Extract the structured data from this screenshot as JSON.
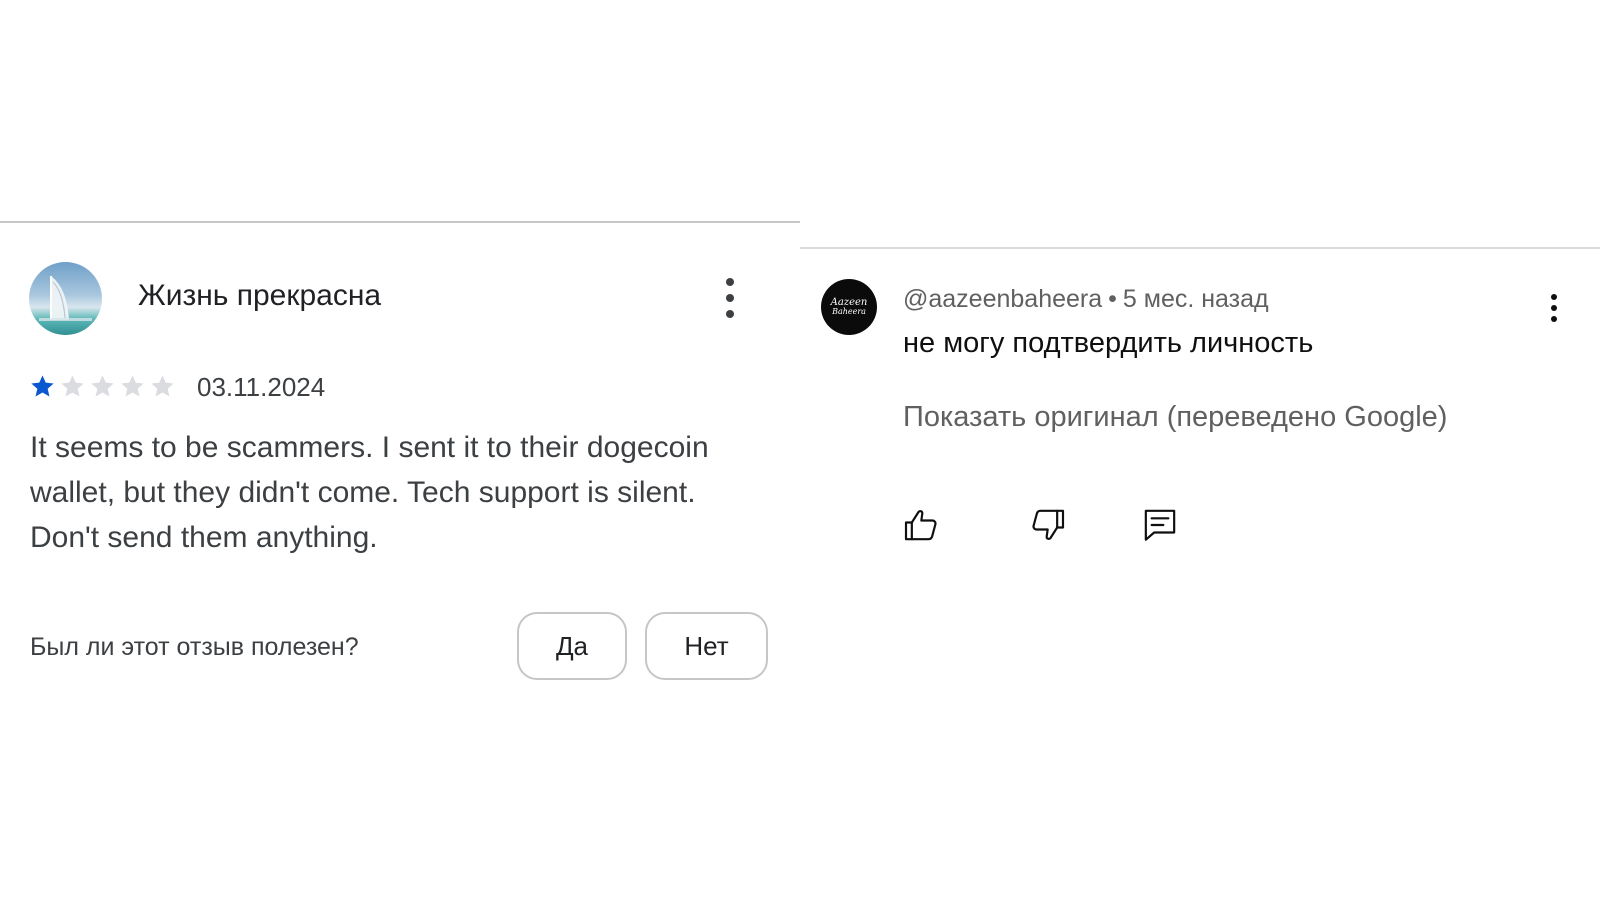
{
  "play_review": {
    "reviewer_name": "Жизнь прекрасна",
    "rating": 1,
    "max_rating": 5,
    "date": "03.11.2024",
    "text": "It seems to be scammers. I sent it to their dogecoin wallet, but they didn't come. Tech support is silent. Don't send them anything.",
    "helpful_question": "Был ли этот отзыв полезен?",
    "yes_label": "Да",
    "no_label": "Нет"
  },
  "yt_comment": {
    "author": "@aazeenbaheera",
    "separator": "•",
    "time": "5 мес. назад",
    "text": "не могу подтвердить личность",
    "show_original": "Показать оригинал (переведено Google)",
    "avatar_text_line1": "Aazeen",
    "avatar_text_line2": "Baheera"
  },
  "colors": {
    "star_filled": "#0b57d0",
    "star_empty": "#dadce0",
    "divider": "#c4c7c5",
    "text_secondary": "#606060"
  },
  "icons": {
    "like": "thumb-up-outline",
    "dislike": "thumb-down-outline",
    "reply": "comment-outline",
    "more": "vertical-ellipsis"
  }
}
